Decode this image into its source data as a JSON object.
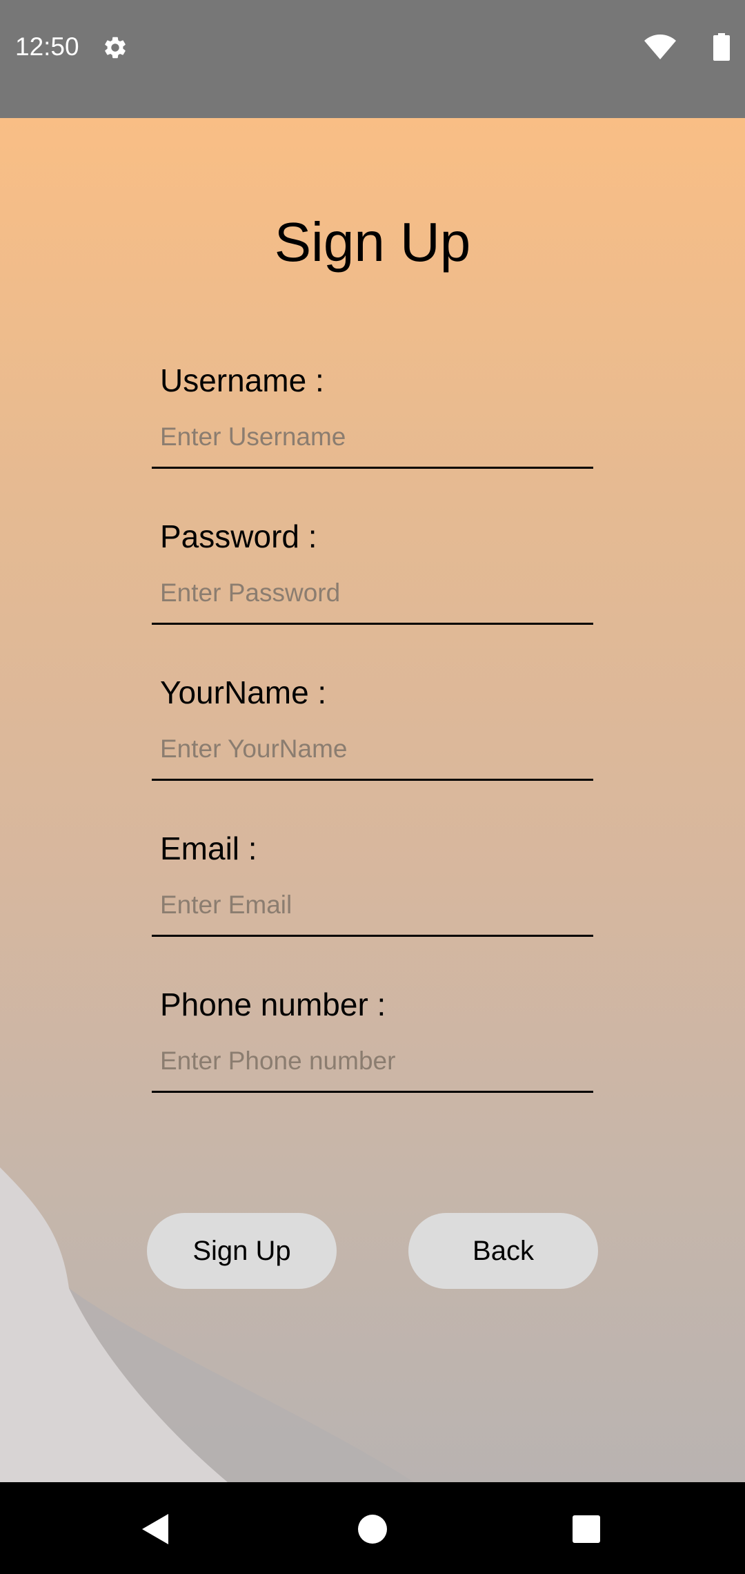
{
  "status_bar": {
    "time": "12:50",
    "icons": [
      "gear-icon",
      "wifi-icon",
      "battery-icon"
    ]
  },
  "page": {
    "title": "Sign Up"
  },
  "form": {
    "fields": [
      {
        "label": "Username :",
        "placeholder": "Enter Username",
        "value": ""
      },
      {
        "label": "Password :",
        "placeholder": "Enter Password",
        "value": ""
      },
      {
        "label": "YourName :",
        "placeholder": "Enter YourName",
        "value": ""
      },
      {
        "label": "Email :",
        "placeholder": "Enter Email",
        "value": ""
      },
      {
        "label": "Phone number :",
        "placeholder": "Enter Phone number",
        "value": ""
      }
    ]
  },
  "buttons": {
    "signup_label": "Sign Up",
    "back_label": "Back"
  },
  "nav_bar": {
    "icons": [
      "back-triangle-icon",
      "home-circle-icon",
      "recents-square-icon"
    ]
  },
  "colors": {
    "status_bar": "#777777",
    "gradient_top": "#f9be85",
    "gradient_bottom": "#b9b3b1",
    "button_bg": "#dcdcdc",
    "placeholder": "#8b7d70",
    "nav_bar": "#000000"
  }
}
